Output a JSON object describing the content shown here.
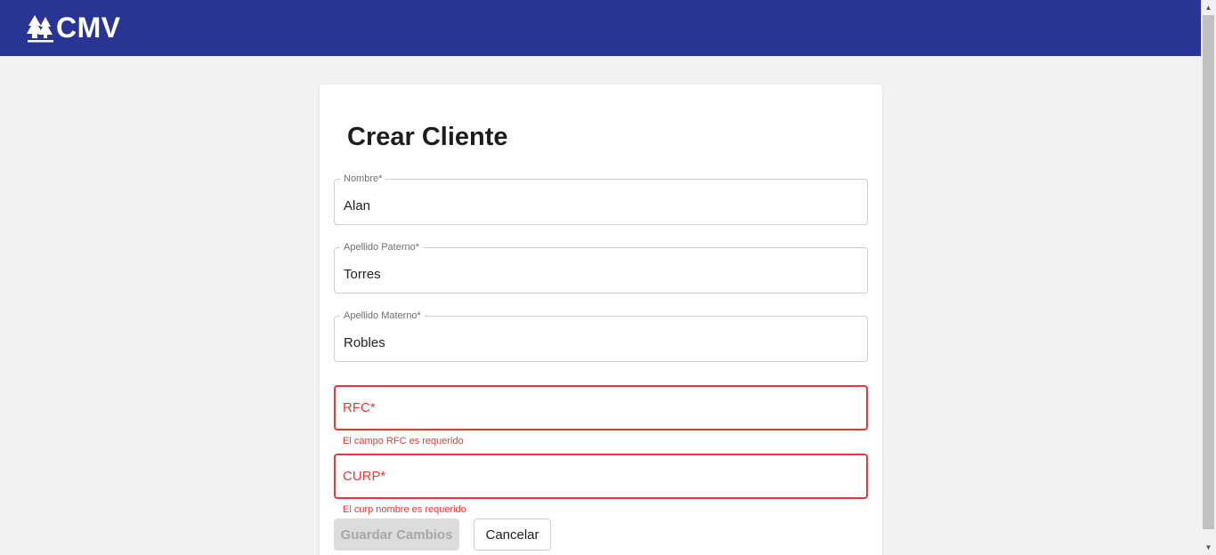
{
  "brand": {
    "name": "CMV",
    "logo_icon": "pine-trees-icon",
    "color": "#283593"
  },
  "form": {
    "title": "Crear Cliente",
    "fields": [
      {
        "label": "Nombre*",
        "value": "Alan"
      },
      {
        "label": "Apellido Paterno*",
        "value": "Torres"
      },
      {
        "label": "Apellido Materno*",
        "value": "Robles"
      },
      {
        "label": "RFC*",
        "value": "",
        "error": "El campo RFC es requerido"
      },
      {
        "label": "CURP*",
        "value": "",
        "error": "El curp nombre es requerido"
      }
    ],
    "error_color": "#e53935"
  },
  "actions": {
    "save_label": "Guardar Cambios",
    "cancel_label": "Cancelar"
  }
}
